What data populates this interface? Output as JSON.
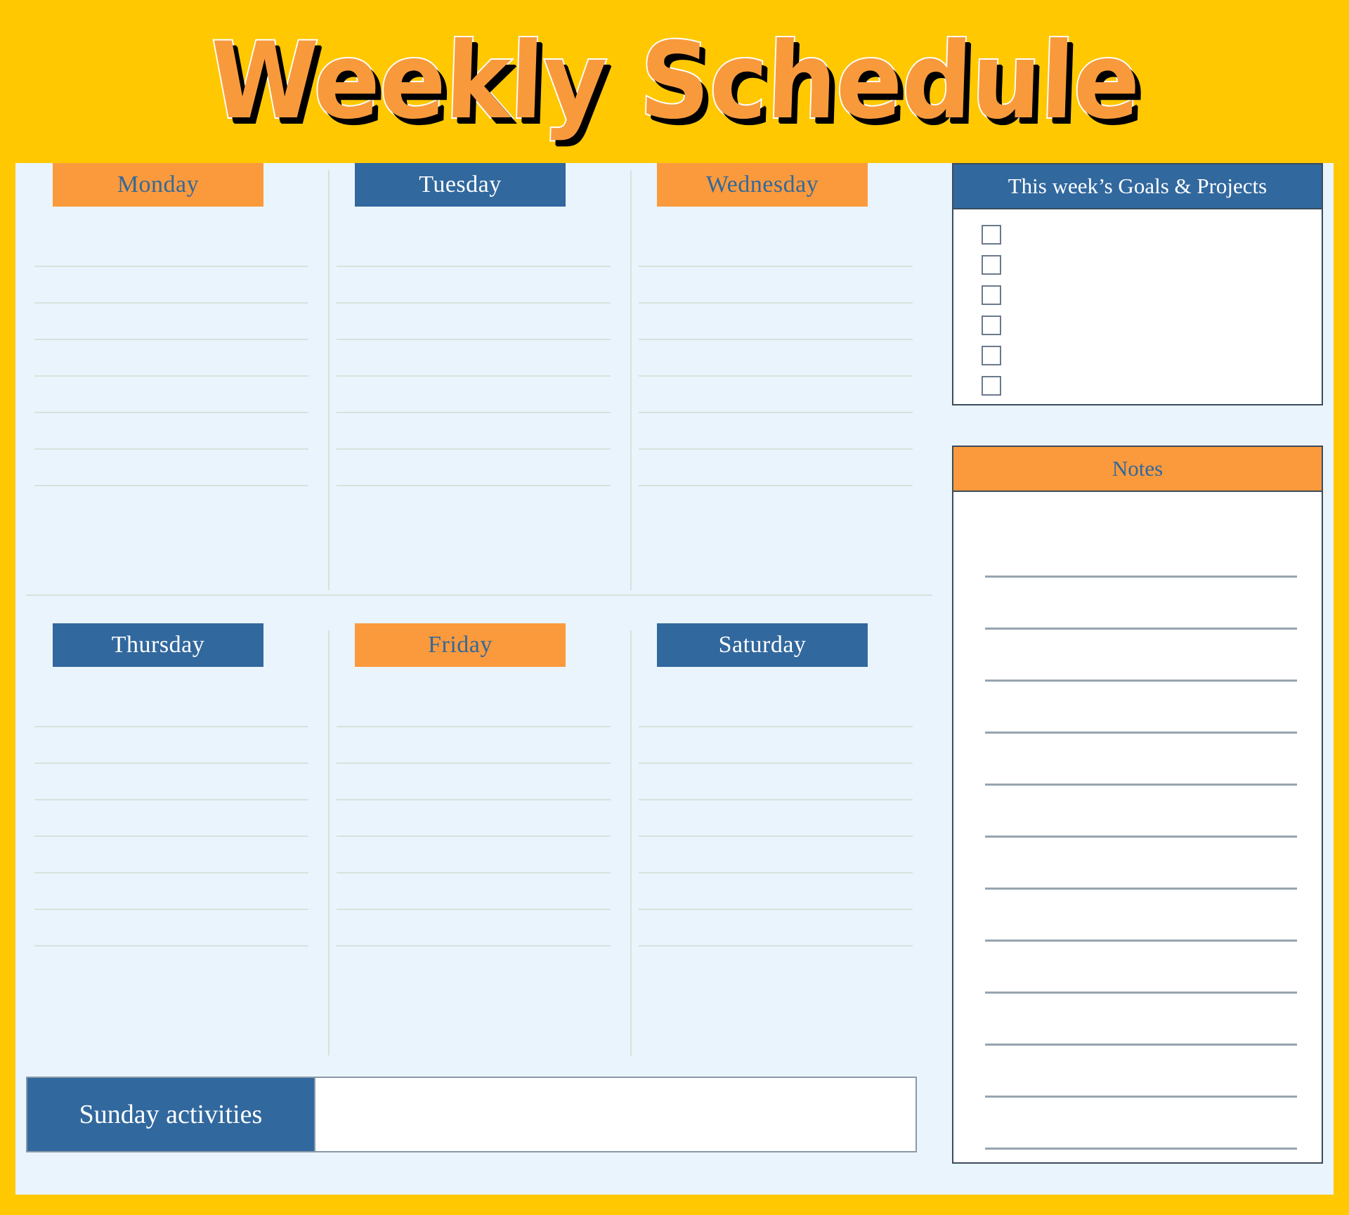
{
  "title": "Weekly Schedule",
  "theme": {
    "frame": "#FFC800",
    "board_bg": "#EAF4FC",
    "orange": "#FB9A3C",
    "blue": "#31689E",
    "rule": "#D8E2DC",
    "notes_rule": "#97A3B0",
    "panel_border": "#3B4B5C"
  },
  "days": [
    {
      "label": "Monday",
      "style": "orange",
      "lines": 7
    },
    {
      "label": "Tuesday",
      "style": "blue",
      "lines": 7
    },
    {
      "label": "Wednesday",
      "style": "orange",
      "lines": 7
    },
    {
      "label": "Thursday",
      "style": "blue",
      "lines": 7
    },
    {
      "label": "Friday",
      "style": "orange",
      "lines": 7
    },
    {
      "label": "Saturday",
      "style": "blue",
      "lines": 7
    }
  ],
  "goals": {
    "header": "This week’s Goals & Projects",
    "checkbox_count": 6,
    "items": [
      "",
      "",
      "",
      "",
      "",
      ""
    ]
  },
  "notes": {
    "header": "Notes",
    "line_count": 12,
    "lines": [
      "",
      "",
      "",
      "",
      "",
      "",
      "",
      "",
      "",
      "",
      "",
      ""
    ]
  },
  "sunday": {
    "label": "Sunday activities",
    "value": "",
    "placeholder": ""
  }
}
